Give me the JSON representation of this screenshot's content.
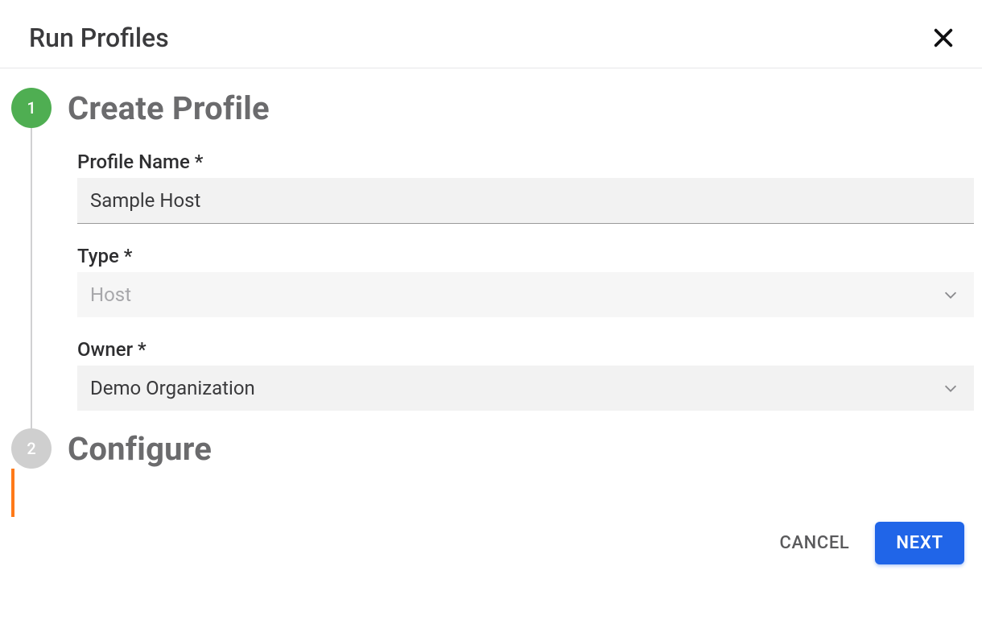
{
  "dialog": {
    "title": "Run Profiles"
  },
  "steps": {
    "create": {
      "number": "1",
      "title": "Create Profile",
      "fields": {
        "profile_name": {
          "label": "Profile Name *",
          "value": "Sample Host"
        },
        "type": {
          "label": "Type *",
          "value": "Host"
        },
        "owner": {
          "label": "Owner *",
          "value": "Demo Organization"
        }
      }
    },
    "configure": {
      "number": "2",
      "title": "Configure"
    }
  },
  "actions": {
    "cancel": "CANCEL",
    "next": "NEXT"
  },
  "colors": {
    "step_active": "#4fae52",
    "step_inactive": "#cfcfcf",
    "accent_line": "#ff7a18",
    "primary_button": "#2065e8"
  }
}
